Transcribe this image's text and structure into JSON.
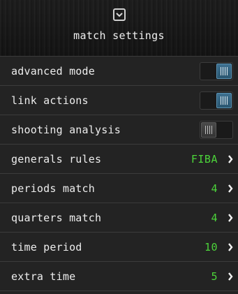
{
  "header": {
    "title": "match settings",
    "collapse_icon": "chevron-down-square-icon"
  },
  "toggles": [
    {
      "label": "advanced mode",
      "on": true
    },
    {
      "label": "link actions",
      "on": true
    },
    {
      "label": "shooting analysis",
      "on": false
    }
  ],
  "options": [
    {
      "label": "generals rules",
      "value": "FIBA"
    },
    {
      "label": "periods match",
      "value": "4"
    },
    {
      "label": "quarters match",
      "value": "4"
    },
    {
      "label": "time period",
      "value": "10"
    },
    {
      "label": "extra time",
      "value": "5"
    }
  ],
  "colors": {
    "accent_value": "#4cd43a",
    "toggle_on": "#3e7090",
    "background": "#232323"
  }
}
